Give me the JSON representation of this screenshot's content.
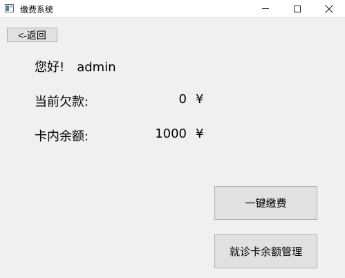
{
  "window": {
    "title": "缴费系统",
    "icon": "app-window-icon"
  },
  "nav": {
    "back_label": "<-返回"
  },
  "info": {
    "greeting": "您好!",
    "username": "admin",
    "debt_label": "当前欠款:",
    "debt_value": "0",
    "debt_currency": "¥",
    "balance_label": "卡内余额:",
    "balance_value": "1000",
    "balance_currency": "¥"
  },
  "actions": {
    "pay_label": "一键缴费",
    "manage_label": "就诊卡余额管理"
  }
}
